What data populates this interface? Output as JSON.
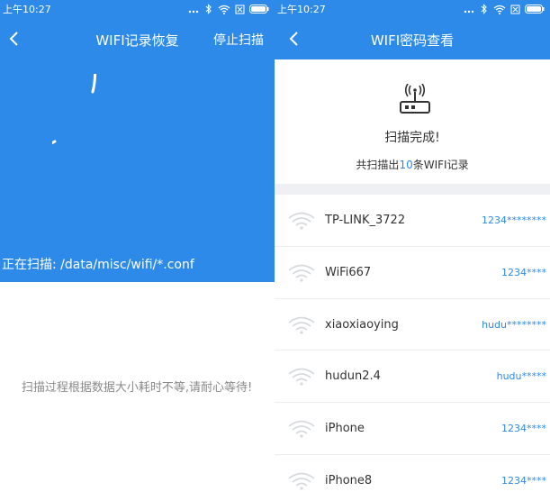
{
  "left": {
    "status_time": "上午10:27",
    "title": "WIFI记录恢复",
    "stop_label": "停止扫描",
    "scan_path": "正在扫描: /data/misc/wifi/*.conf",
    "hint": "扫描过程根据数据大小耗时不等,请耐心等待!",
    "icons": [
      "more-dots-icon",
      "bluetooth-icon",
      "wifi-icon",
      "sim-icon",
      "battery-icon",
      "back-arrow-icon",
      "progress-ring"
    ]
  },
  "right": {
    "status_time": "上午10:27",
    "title": "WIFI密码查看",
    "done_text": "扫描完成!",
    "count_prefix": "共扫描出",
    "count_value": "10",
    "count_suffix": "条WIFI记录",
    "networks": [
      {
        "ssid": "TP-LINK_3722",
        "password": "1234********"
      },
      {
        "ssid": "WiFi667",
        "password": "1234****"
      },
      {
        "ssid": "xiaoxiaoying",
        "password": "hudu********"
      },
      {
        "ssid": "hudun2.4",
        "password": "hudu*****"
      },
      {
        "ssid": "iPhone",
        "password": "1234****"
      },
      {
        "ssid": "iPhone8",
        "password": "1234****"
      }
    ],
    "icons": [
      "router-icon",
      "wifi-signal-icon"
    ]
  },
  "colors": {
    "accent": "#2e8ae8",
    "text": "#333333",
    "hint": "#8a8a8a"
  }
}
